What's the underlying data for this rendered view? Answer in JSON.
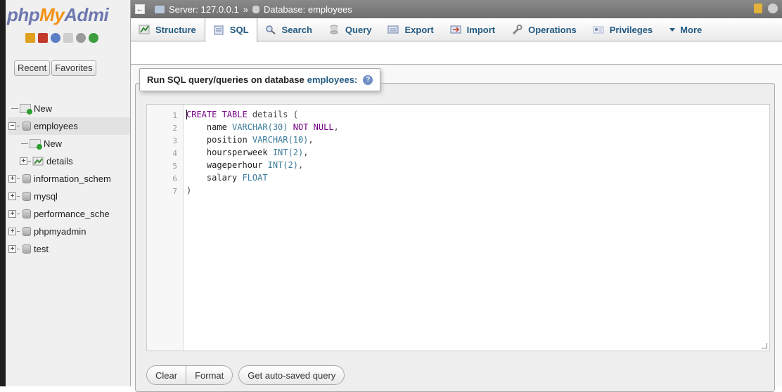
{
  "logo": {
    "part1": "php",
    "part2": "My",
    "part3": "Admi"
  },
  "nav": {
    "recent_label": "Recent",
    "favorites_label": "Favorites",
    "tree": [
      {
        "label": "New"
      },
      {
        "label": "employees"
      },
      {
        "label": "New"
      },
      {
        "label": "details"
      },
      {
        "label": "information_schem"
      },
      {
        "label": "mysql"
      },
      {
        "label": "performance_sche"
      },
      {
        "label": "phpmyadmin"
      },
      {
        "label": "test"
      }
    ]
  },
  "topbar": {
    "server_label": "Server: 127.0.0.1",
    "separator": "»",
    "database_label": "Database: employees"
  },
  "tabs": [
    {
      "label": "Structure",
      "icon": "structure-icon"
    },
    {
      "label": "SQL",
      "icon": "sql-icon",
      "active": true
    },
    {
      "label": "Search",
      "icon": "search-icon"
    },
    {
      "label": "Query",
      "icon": "query-icon"
    },
    {
      "label": "Export",
      "icon": "export-icon"
    },
    {
      "label": "Import",
      "icon": "import-icon"
    },
    {
      "label": "Operations",
      "icon": "operations-icon"
    },
    {
      "label": "Privileges",
      "icon": "privileges-icon"
    },
    {
      "label": "More",
      "icon": "chevron-down-icon"
    }
  ],
  "sql_panel": {
    "legend_text": "Run SQL query/queries on database",
    "database_name": "employees:",
    "line_numbers": [
      "1",
      "2",
      "3",
      "4",
      "5",
      "6",
      "7"
    ],
    "code": {
      "l1_kw": "CREATE TABLE",
      "l1_rest": " details (",
      "l2_name": "    name ",
      "l2_type": "VARCHAR(30)",
      "l2_kw": " NOT NULL",
      "l2_end": ",",
      "l3_name": "    position ",
      "l3_type": "VARCHAR(10)",
      "l3_end": ",",
      "l4_name": "    hoursperweek ",
      "l4_type": "INT(2)",
      "l4_end": ",",
      "l5_name": "    wageperhour ",
      "l5_type": "INT(2)",
      "l5_end": ",",
      "l6_name": "    salary ",
      "l6_type": "FLOAT",
      "l7": ")"
    }
  },
  "buttons": {
    "clear": "Clear",
    "format": "Format",
    "get_autosaved": "Get auto-saved query"
  },
  "colors": {
    "accent_link": "#235a81",
    "logo_blue": "#6c78af",
    "logo_orange": "#f29111",
    "topbar": "#7d7d7d"
  }
}
